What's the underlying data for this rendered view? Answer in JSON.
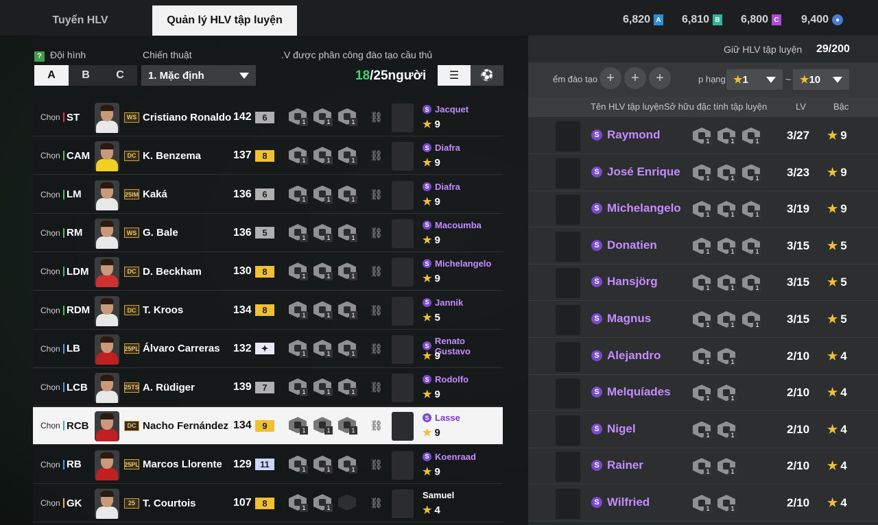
{
  "tabs": [
    {
      "label": "Tuyển HLV"
    },
    {
      "label": "Quản lý HLV tập luyện"
    }
  ],
  "currencies": [
    {
      "value": "6,820",
      "icon": "A",
      "color": "#2a8fd8"
    },
    {
      "value": "6,810",
      "icon": "B",
      "color": "#2ab89a"
    },
    {
      "value": "6,800",
      "icon": "C",
      "color": "#b04ad8"
    },
    {
      "value": "9,400",
      "icon": "coin-icon",
      "color": "#4a7ad8"
    }
  ],
  "left": {
    "formation_label": "Đội hình",
    "tactic_label": "Chiến thuật",
    "assigned_label": ".V được phân công đào tạo cầu thủ",
    "formation_buttons": [
      "A",
      "B",
      "C"
    ],
    "tactic_value": "1. Mặc định",
    "assigned_count": "18",
    "assigned_total": "/25người"
  },
  "players": [
    {
      "chon": "Chọn",
      "pos": "ST",
      "season": "WS",
      "name": "Cristiano Ronaldo",
      "ovr": "142",
      "lvl": "6",
      "lvlcolor": "#b0b0b0",
      "traits": [
        "1",
        "1",
        "1"
      ],
      "coach": "Jacquet",
      "cstars": "9",
      "s": true,
      "jersey": "#e8e8e8"
    },
    {
      "chon": "Chọn",
      "pos": "CAM",
      "season": "DC",
      "name": "K. Benzema",
      "ovr": "137",
      "lvl": "8",
      "lvlcolor": "#f0c030",
      "traits": [
        "1",
        "1",
        "1"
      ],
      "coach": "Diafra",
      "cstars": "9",
      "s": true,
      "jersey": "#f0d020"
    },
    {
      "chon": "Chọn",
      "pos": "LM",
      "season": "25IM",
      "name": "Kaká",
      "ovr": "136",
      "lvl": "6",
      "lvlcolor": "#b0b0b0",
      "traits": [
        "1",
        "1",
        "1"
      ],
      "coach": "Diafra",
      "cstars": "9",
      "s": true,
      "jersey": "#e8e8e8"
    },
    {
      "chon": "Chọn",
      "pos": "RM",
      "season": "WS",
      "name": "G. Bale",
      "ovr": "136",
      "lvl": "5",
      "lvlcolor": "#b0b0b0",
      "traits": [
        "1",
        "1",
        "1"
      ],
      "coach": "Macoumba",
      "cstars": "9",
      "s": true,
      "jersey": "#e8e8e8"
    },
    {
      "chon": "Chọn",
      "pos": "LDM",
      "season": "DC",
      "name": "D. Beckham",
      "ovr": "130",
      "lvl": "8",
      "lvlcolor": "#f0c030",
      "traits": [
        "1",
        "1",
        "1"
      ],
      "coach": "Michelangelo",
      "cstars": "9",
      "s": true,
      "jersey": "#d03030"
    },
    {
      "chon": "Chọn",
      "pos": "RDM",
      "season": "DC",
      "name": "T. Kroos",
      "ovr": "134",
      "lvl": "8",
      "lvlcolor": "#f0c030",
      "traits": [
        "1",
        "1",
        "1"
      ],
      "coach": "Jannik",
      "cstars": "5",
      "s": true,
      "jersey": "#e8e8e8"
    },
    {
      "chon": "Chọn",
      "pos": "LB",
      "season": "25PL",
      "name": "Álvaro Carreras",
      "ovr": "132",
      "lvl": "✦",
      "lvlcolor": "#e8e8f8",
      "traits": [
        "1",
        "1",
        "1"
      ],
      "coach": "Renato Gustavo",
      "cstars": "9",
      "s": true,
      "jersey": "#c02020"
    },
    {
      "chon": "Chọn",
      "pos": "LCB",
      "season": "25TS",
      "name": "A. Rüdiger",
      "ovr": "139",
      "lvl": "7",
      "lvlcolor": "#b0b0b0",
      "traits": [
        "1",
        "1",
        "1"
      ],
      "coach": "Rodolfo",
      "cstars": "9",
      "s": true,
      "jersey": "#e8e8e8"
    },
    {
      "chon": "Chọn",
      "pos": "RCB",
      "season": "DC",
      "name": "Nacho Fernández",
      "ovr": "134",
      "lvl": "9",
      "lvlcolor": "#f0c030",
      "traits": [
        "1",
        "1",
        "1"
      ],
      "coach": "Lasse",
      "cstars": "9",
      "s": true,
      "jersey": "#c02020"
    },
    {
      "chon": "Chọn",
      "pos": "RB",
      "season": "25PL",
      "name": "Marcos Llorente",
      "ovr": "129",
      "lvl": "11",
      "lvlcolor": "#c8d8f8",
      "traits": [
        "1",
        "1",
        "1"
      ],
      "coach": "Koenraad",
      "cstars": "9",
      "s": true,
      "jersey": "#c02020"
    },
    {
      "chon": "Chọn",
      "pos": "GK",
      "season": "25",
      "name": "T. Courtois",
      "ovr": "107",
      "lvl": "8",
      "lvlcolor": "#f0c030",
      "traits": [
        "1",
        "1",
        ""
      ],
      "coach": "Samuel",
      "cstars": "4",
      "s": false,
      "jersey": "#e8e8e8"
    }
  ],
  "right": {
    "keep_label": "Giữ HLV tập luyện",
    "keep_value": "29/200",
    "train_label": "ểm đào tạo",
    "rank_label": "p hạng",
    "rank_from": "1",
    "rank_sep": "~",
    "rank_to": "10",
    "col_name": "Tên HLV tập luyện",
    "col_traits": "Sở hữu đặc tính tập luyện",
    "col_lv": "LV",
    "col_rank": "Bậc"
  },
  "coaches": [
    {
      "name": "Raymond",
      "lv": "3/27",
      "rank": "9",
      "traits": [
        "1",
        "1",
        "1"
      ],
      "skin": "#6a4030"
    },
    {
      "name": "José Enrique",
      "lv": "3/23",
      "rank": "9",
      "traits": [
        "1",
        "1",
        "1"
      ],
      "skin": "#c99a7a"
    },
    {
      "name": "Michelangelo",
      "lv": "3/19",
      "rank": "9",
      "traits": [
        "1",
        "1",
        "1"
      ],
      "skin": "#7a5038"
    },
    {
      "name": "Donatien",
      "lv": "3/15",
      "rank": "5",
      "traits": [
        "1",
        "1",
        "1"
      ],
      "skin": "#8a6a50"
    },
    {
      "name": "Hansjörg",
      "lv": "3/15",
      "rank": "5",
      "traits": [
        "1",
        "1",
        "1"
      ],
      "skin": "#d8b090"
    },
    {
      "name": "Magnus",
      "lv": "3/15",
      "rank": "5",
      "traits": [
        "1",
        "1",
        "1"
      ],
      "skin": "#d8b090"
    },
    {
      "name": "Alejandro",
      "lv": "2/10",
      "rank": "4",
      "traits": [
        "1",
        "1"
      ],
      "skin": "#c99a7a"
    },
    {
      "name": "Melquíades",
      "lv": "2/10",
      "rank": "4",
      "traits": [
        "1",
        "1"
      ],
      "skin": "#c99a7a"
    },
    {
      "name": "Nigel",
      "lv": "2/10",
      "rank": "4",
      "traits": [
        "1",
        "1"
      ],
      "skin": "#4a2a1a"
    },
    {
      "name": "Rainer",
      "lv": "2/10",
      "rank": "4",
      "traits": [
        "1",
        "1"
      ],
      "skin": "#5a3a2a"
    },
    {
      "name": "Wilfried",
      "lv": "2/10",
      "rank": "4",
      "traits": [
        "1",
        "1"
      ],
      "skin": "#3a2218"
    }
  ]
}
